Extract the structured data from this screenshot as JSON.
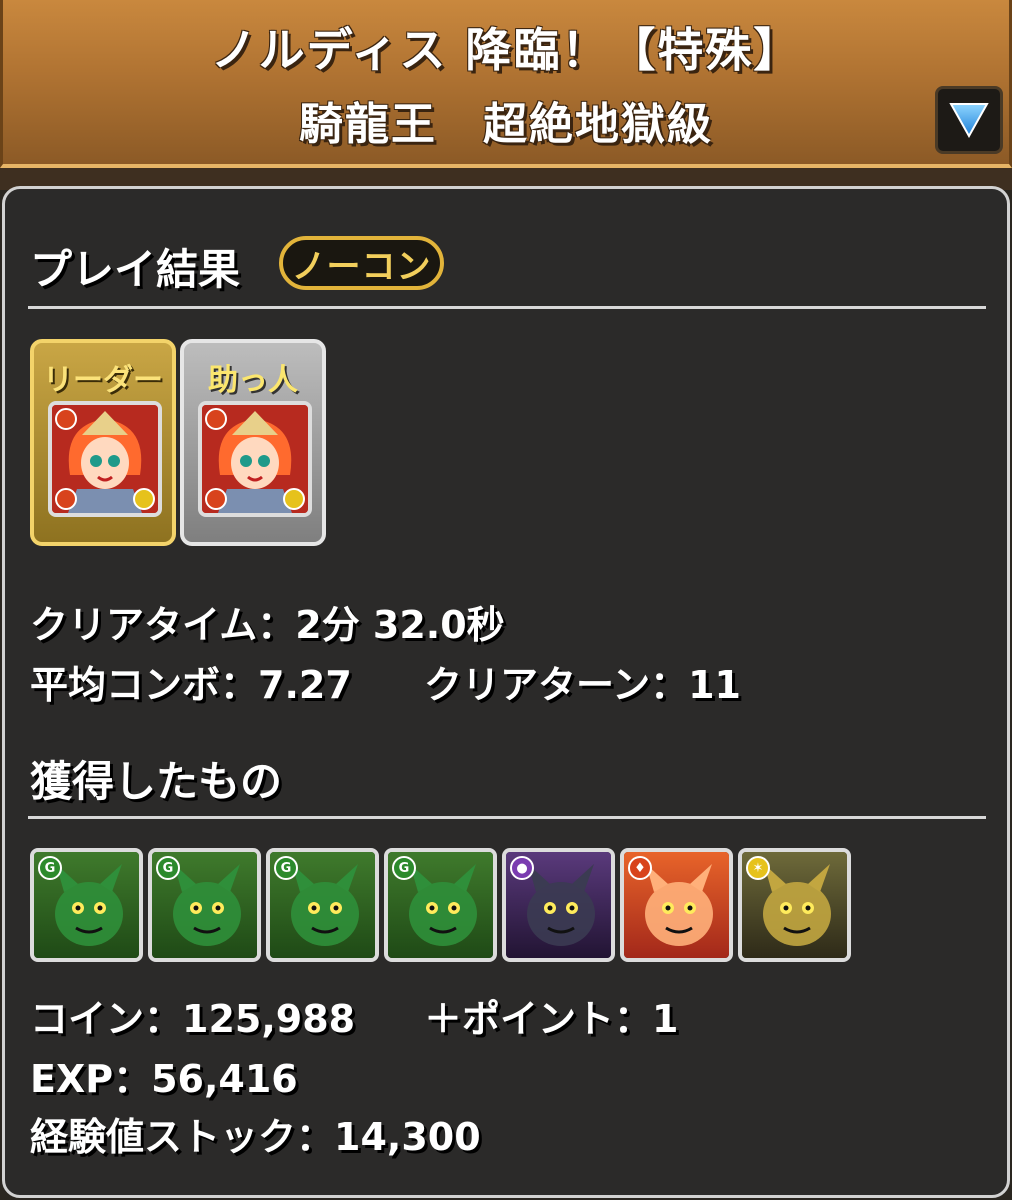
{
  "header": {
    "title": "ノルディス 降臨！【特殊】",
    "subtitle": "騎龍王　超絶地獄級",
    "dropdown_icon": "triangle-down-icon"
  },
  "play_result": {
    "heading": "プレイ結果",
    "badge": "ノーコン"
  },
  "team": {
    "leader_label": "リーダー",
    "helper_label": "助っ人"
  },
  "stats": {
    "clear_time_label": "クリアタイム：",
    "clear_time_value": "2分 32.0秒",
    "avg_combo_label": "平均コンボ：",
    "avg_combo_value": "7.27",
    "clear_turns_label": "クリアターン：",
    "clear_turns_value": "11"
  },
  "rewards": {
    "heading": "獲得したもの",
    "monsters": [
      {
        "attr": "wood",
        "icon": "dark-red-dragon-icon"
      },
      {
        "attr": "wood",
        "icon": "armored-turtle-dragon-icon"
      },
      {
        "attr": "wood",
        "icon": "green-dragon-icon"
      },
      {
        "attr": "wood",
        "icon": "green-fairy-icon"
      },
      {
        "attr": "dark",
        "icon": "dark-dragon-icon"
      },
      {
        "attr": "fire",
        "icon": "fire-dragon-icon"
      },
      {
        "attr": "light",
        "icon": "gold-dragon-icon"
      }
    ]
  },
  "totals": {
    "coin_label": "コイン：",
    "coin_value": "125,988",
    "plus_label": "＋ポイント：",
    "plus_value": "1",
    "exp_label": "EXP：",
    "exp_value": "56,416",
    "stock_label": "経験値ストック：",
    "stock_value": "14,300"
  },
  "colors": {
    "header_brown": "#b07332",
    "panel": "#2b2a29",
    "gold": "#e2b43a",
    "wood": "#2c8a2c",
    "fire": "#d8431c",
    "dark": "#7a3cb0",
    "light": "#e6c21c"
  }
}
